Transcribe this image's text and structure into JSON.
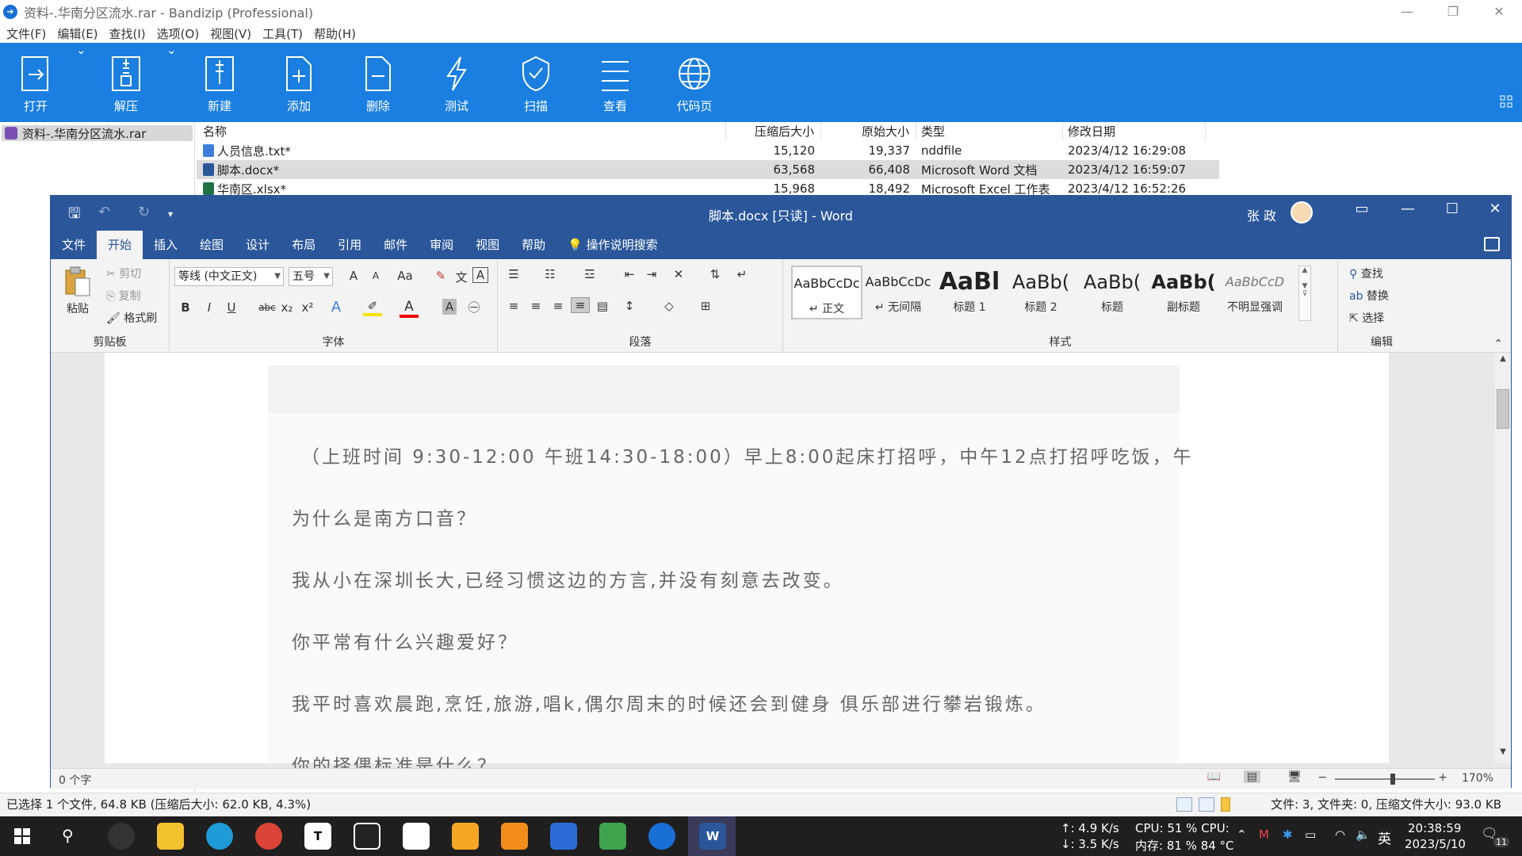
{
  "bandizip": {
    "title": "资料-.华南分区流水.rar - Bandizip (Professional)",
    "window_controls": {
      "minimize": "—",
      "restore": "❐",
      "close": "✕"
    },
    "menu": [
      "文件(F)",
      "编辑(E)",
      "查找(I)",
      "选项(O)",
      "视图(V)",
      "工具(T)",
      "帮助(H)"
    ],
    "toolbar": [
      {
        "label": "打开",
        "icon": "open-archive-icon"
      },
      {
        "label": "解压",
        "icon": "extract-icon"
      },
      {
        "label": "新建",
        "icon": "new-archive-icon"
      },
      {
        "label": "添加",
        "icon": "add-file-icon"
      },
      {
        "label": "删除",
        "icon": "delete-file-icon"
      },
      {
        "label": "测试",
        "icon": "test-lightning-icon"
      },
      {
        "label": "扫描",
        "icon": "scan-shield-icon"
      },
      {
        "label": "查看",
        "icon": "view-list-icon"
      },
      {
        "label": "代码页",
        "icon": "codepage-globe-icon"
      }
    ],
    "tree": {
      "root": "资料-.华南分区流水.rar"
    },
    "list": {
      "headers": {
        "name": "名称",
        "compressed": "压缩后大小",
        "original": "原始大小",
        "type": "类型",
        "modified": "修改日期"
      },
      "rows": [
        {
          "name": "人员信息.txt*",
          "compressed": "15,120",
          "original": "19,337",
          "type": "nddfile",
          "modified": "2023/4/12 16:29:08",
          "icon": "txt-file-icon",
          "color": "#3d7fd9"
        },
        {
          "name": "脚本.docx*",
          "compressed": "63,568",
          "original": "66,408",
          "type": "Microsoft Word 文档",
          "modified": "2023/4/12 16:59:07",
          "icon": "word-file-icon",
          "color": "#2b579a"
        },
        {
          "name": "华南区.xlsx*",
          "compressed": "15,968",
          "original": "18,492",
          "type": "Microsoft Excel 工作表",
          "modified": "2023/4/12 16:52:26",
          "icon": "excel-file-icon",
          "color": "#217346"
        }
      ]
    },
    "status": {
      "left": "已选择 1 个文件, 64.8 KB (压缩后大小: 62.0 KB, 4.3%)",
      "right": "文件: 3, 文件夹: 0, 压缩文件大小: 93.0 KB"
    }
  },
  "word": {
    "title": "脚本.docx [只读]  -  Word",
    "user": "张 政",
    "qat": {
      "save": "🖫",
      "undo": "↶",
      "redo": "↻",
      "customize": "▾"
    },
    "window_controls": {
      "ribbon_display": "▭",
      "minimize": "—",
      "maximize": "☐",
      "close": "✕"
    },
    "tabs": [
      "文件",
      "开始",
      "插入",
      "绘图",
      "设计",
      "布局",
      "引用",
      "邮件",
      "审阅",
      "视图",
      "帮助"
    ],
    "active_tab": "开始",
    "tell_me": "操作说明搜索",
    "clipboard": {
      "paste": "粘贴",
      "cut": "剪切",
      "copy": "复制",
      "format_painter": "格式刷",
      "label": "剪贴板"
    },
    "font": {
      "name": "等线 (中文正文)",
      "size": "五号",
      "label": "字体",
      "grow": "A",
      "shrink": "A",
      "case": "Aa",
      "bold": "B",
      "italic": "I",
      "underline": "U",
      "strike": "abc",
      "sub": "x₂",
      "sup": "x²",
      "effects": "A",
      "color": "A",
      "shade": "A"
    },
    "paragraph": {
      "label": "段落"
    },
    "styles": {
      "label": "样式",
      "items": [
        {
          "sample": "AaBbCcDc",
          "name": "↵ 正文"
        },
        {
          "sample": "AaBbCcDc",
          "name": "↵ 无间隔"
        },
        {
          "sample": "AaBl",
          "name": "标题 1"
        },
        {
          "sample": "AaBb(",
          "name": "标题 2"
        },
        {
          "sample": "AaBb(",
          "name": "标题"
        },
        {
          "sample": "AaBb(",
          "name": "副标题"
        },
        {
          "sample": "AaBbCcD",
          "name": "不明显强调"
        }
      ]
    },
    "editing": {
      "find": "查找",
      "replace": "替换",
      "select": "选择",
      "label": "编辑"
    },
    "document_lines": [
      "（上班时间 9:30-12:00 午班14:30-18:00）早上8:00起床打招呼，中午12点打招呼吃饭，午",
      "为什么是南方口音？",
      "我从小在深圳长大,已经习惯这边的方言,并没有刻意去改变。",
      "你平常有什么兴趣爱好？",
      "我平时喜欢晨跑,烹饪,旅游,唱k,偶尔周末的时候还会到健身 俱乐部进行攀岩锻炼。",
      "你的择偶标准是什么？"
    ],
    "status": {
      "word_count": "0 个字",
      "zoom": "170%",
      "zoom_minus": "−",
      "zoom_plus": "+"
    }
  },
  "taskbar": {
    "net_up": "↑: 4.9 K/s",
    "net_down": "↓: 3.5 K/s",
    "cpu": "CPU: 51 % CPU:",
    "mem": "内存: 81 % 84 °C",
    "ime": "英",
    "time": "20:38:59",
    "date": "2023/5/10",
    "notifications": "11"
  }
}
